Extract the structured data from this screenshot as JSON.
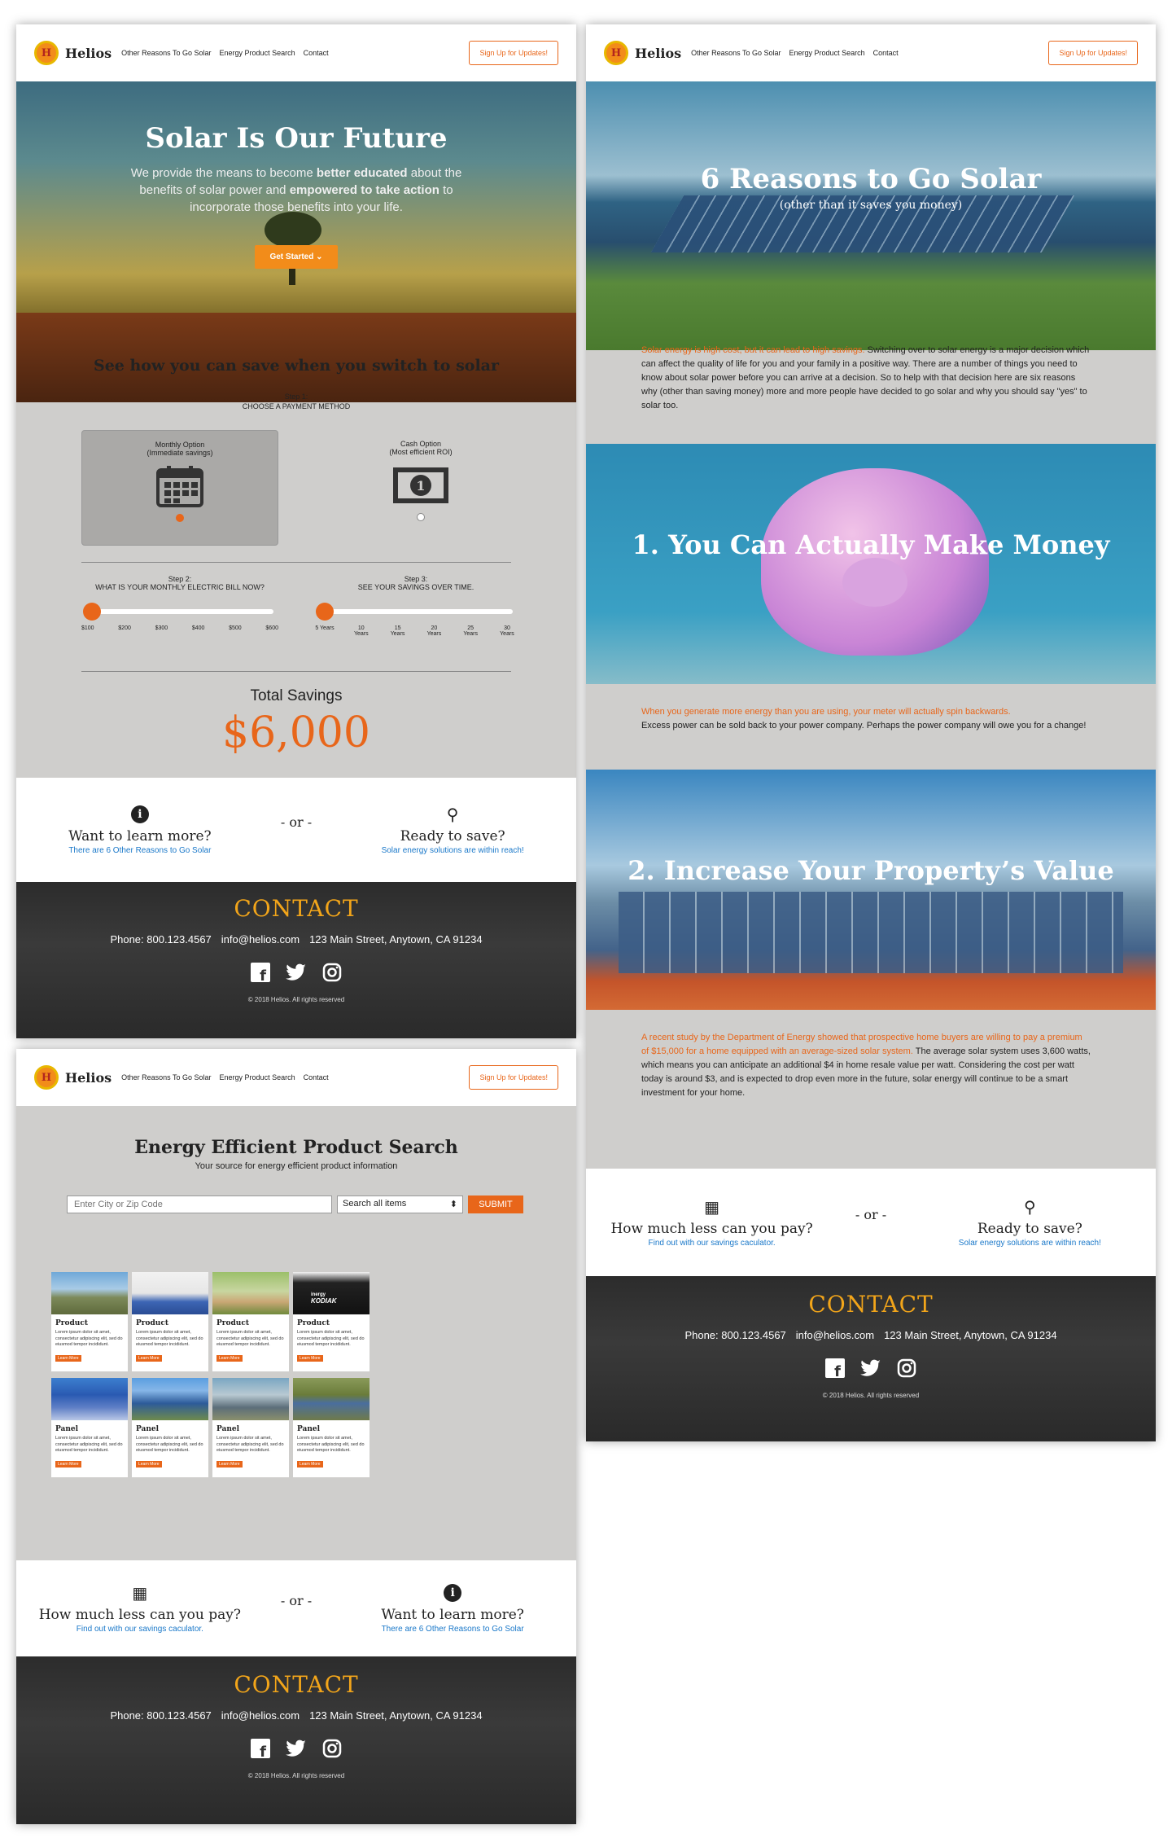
{
  "nav": {
    "brand": "Helios",
    "links": [
      "Other Reasons To Go Solar",
      "Energy Product Search",
      "Contact"
    ],
    "cta": "Sign Up for Updates!"
  },
  "home": {
    "hero_title": "Solar Is Our Future",
    "hero_p1": "We provide the means to become ",
    "hero_b1": "better educated",
    "hero_p2": " about the benefits of solar power and ",
    "hero_b2": "empowered to take action",
    "hero_p3": " to incorporate those benefits into your life.",
    "hero_button": "Get Started",
    "calc_title": "See how you can save when you switch to solar",
    "step1_label": "Step 1:",
    "step1_text": "CHOOSE A PAYMENT METHOD",
    "option_monthly": "Monthly Option",
    "option_monthly_sub": "(Immediate savings)",
    "option_cash": "Cash Option",
    "option_cash_sub": "(Most efficient ROI)",
    "step2_label": "Step 2:",
    "step2_text": "WHAT IS YOUR MONTHLY ELECTRIC BILL NOW?",
    "step3_label": "Step 3:",
    "step3_text": "SEE YOUR SAVINGS OVER TIME.",
    "bill_ticks": [
      "$100",
      "$200",
      "$300",
      "$400",
      "$500",
      "$600"
    ],
    "year_ticks": [
      "5 Years",
      "10 Years",
      "15 Years",
      "20 Years",
      "25 Years",
      "30 Years"
    ],
    "total_label": "Total Savings",
    "total_value": "$6,000",
    "cta_left_title": "Want to learn more?",
    "cta_left_sub": "There are 6 Other Reasons to Go Solar",
    "cta_or": "- or -",
    "cta_right_title": "Ready to save?",
    "cta_right_sub": "Solar energy solutions are within reach!"
  },
  "reasons": {
    "hero_title": "6 Reasons to Go Solar",
    "hero_sub": "(other than it saves you money)",
    "intro_highlight": "Solar energy is high cost, but it can lead to high savings.",
    "intro_text": " Switching over to solar energy is a major decision which can affect the quality of life for you and your family in a positive way. There are a number of things you need to know about solar power before you can arrive at a decision. So to help with that decision here are six reasons why (other than saving money) more and more people have decided to go solar and why you should say \"yes\" to solar too.",
    "r1_title": "1. You Can Actually Make Money",
    "r1_highlight": "When you generate more energy than you are using, your meter will actually spin backwards.",
    "r1_text": "Excess power can be sold back to your power company. Perhaps the power company will owe you for a change!",
    "r2_title": "2. Increase Your Property’s Value",
    "r2_highlight": "A recent study by the Department of Energy showed that prospective home buyers are willing to pay a premium of $15,000 for a home equipped with an average-sized solar system.",
    "r2_text": " The average solar system uses 3,600 watts, which means you can anticipate an additional $4 in home resale value per watt. Considering the cost per watt today is around $3, and is expected to drop even more in the future, solar energy will continue to be a smart investment for your home.",
    "cta_left_title": "How much less can you pay?",
    "cta_left_sub": "Find out with our savings caculator.",
    "cta_or": "- or -",
    "cta_right_title": "Ready to save?",
    "cta_right_sub": "Solar energy solutions are within reach!"
  },
  "search": {
    "title": "Energy Efficient Product Search",
    "subtitle": "Your source for energy efficient product information",
    "location_placeholder": "Enter City or Zip Code",
    "select_value": "Search all items",
    "submit": "SUBMIT",
    "products": [
      {
        "title": "Product",
        "desc": "Lorem ipsum dolor sit amet, consectetur adipiscing elit, sed do eiusmod tempor incididunt.",
        "btn": "Learn More",
        "img": "bike"
      },
      {
        "title": "Product",
        "desc": "Lorem ipsum dolor sit amet, consectetur adipiscing elit, sed do eiusmod tempor incididunt.",
        "btn": "Learn More",
        "img": "lamp"
      },
      {
        "title": "Product",
        "desc": "Lorem ipsum dolor sit amet, consectetur adipiscing elit, sed do eiusmod tempor incididunt.",
        "btn": "Learn More",
        "img": "chair"
      },
      {
        "title": "Product",
        "desc": "Lorem ipsum dolor sit amet, consectetur adipiscing elit, sed do eiusmod tempor incididunt.",
        "btn": "Learn More",
        "img": "kodiak",
        "img_text": [
          "inergy",
          "KODIAK"
        ]
      },
      {
        "title": "Panel",
        "desc": "Lorem ipsum dolor sit amet, consectetur adipiscing elit, sed do eiusmod tempor incididunt.",
        "btn": "Learn More",
        "img": "roof"
      },
      {
        "title": "Panel",
        "desc": "Lorem ipsum dolor sit amet, consectetur adipiscing elit, sed do eiusmod tempor incididunt.",
        "btn": "Learn More",
        "img": "array"
      },
      {
        "title": "Panel",
        "desc": "Lorem ipsum dolor sit amet, consectetur adipiscing elit, sed do eiusmod tempor incididunt.",
        "btn": "Learn More",
        "img": "small"
      },
      {
        "title": "Panel",
        "desc": "Lorem ipsum dolor sit amet, consectetur adipiscing elit, sed do eiusmod tempor incididunt.",
        "btn": "Learn More",
        "img": "field"
      }
    ],
    "cta_left_title": "How much less can you pay?",
    "cta_left_sub": "Find out with our savings caculator.",
    "cta_or": "- or -",
    "cta_right_title": "Want to learn more?",
    "cta_right_sub": "There are 6 Other Reasons to Go Solar"
  },
  "contact": {
    "heading": "CONTACT",
    "phone": "Phone: 800.123.4567",
    "email": "info@helios.com",
    "address": "123 Main Street, Anytown, CA 91234",
    "copyright": "© 2018 Helios. All rights reserved"
  },
  "colors": {
    "accent": "#e8661a",
    "link": "#1a78c9",
    "panel_bg": "#cfcecc",
    "contact_heading": "#f2a51a"
  }
}
